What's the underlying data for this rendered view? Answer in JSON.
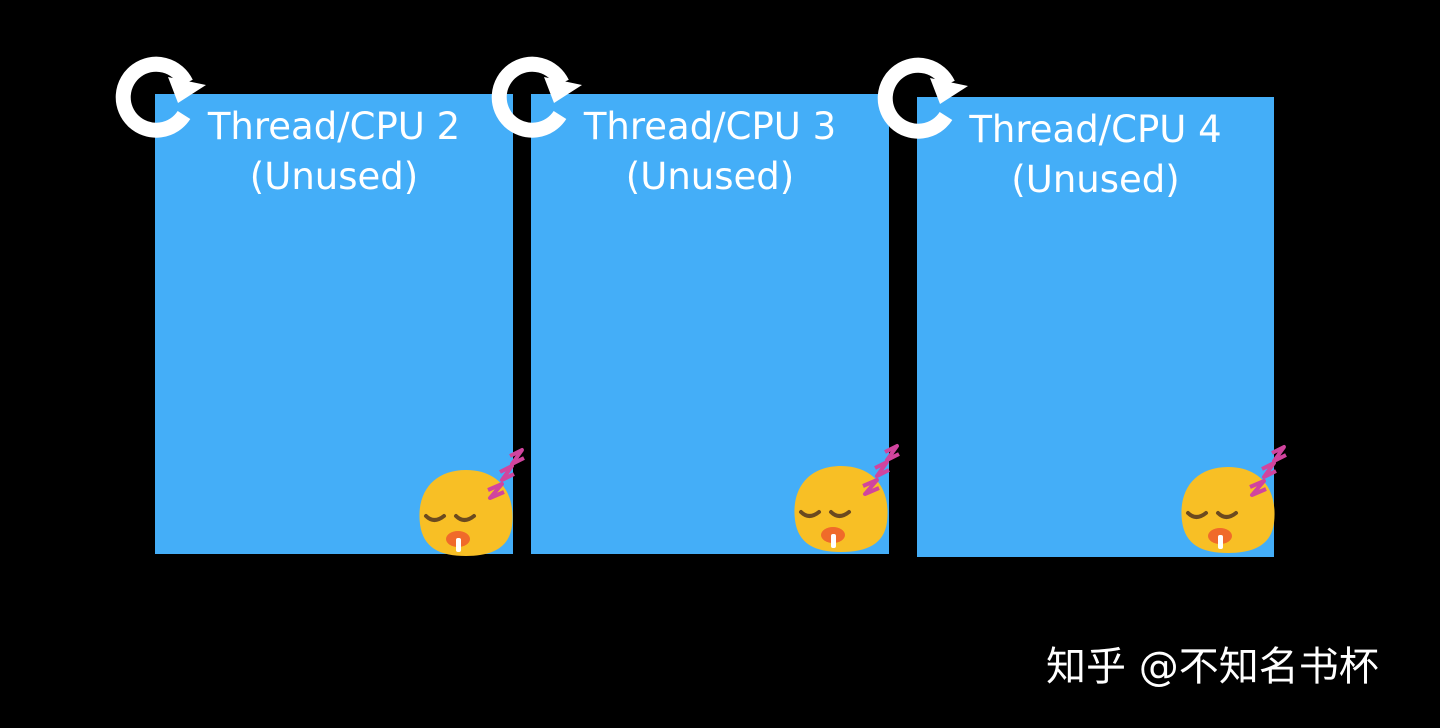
{
  "panels": [
    {
      "line1": "Thread/CPU 2",
      "line2": "(Unused)"
    },
    {
      "line1": "Thread/CPU 3",
      "line2": "(Unused)"
    },
    {
      "line1": "Thread/CPU 4",
      "line2": "(Unused)"
    }
  ],
  "watermark": "知乎 @不知名书杯",
  "colors": {
    "background": "#000000",
    "panel": "#44aef8",
    "text": "#ffffff"
  },
  "icons": [
    "refresh-loop-icon",
    "sleeping-face-icon"
  ]
}
